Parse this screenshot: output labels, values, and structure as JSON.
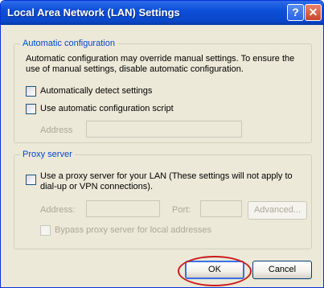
{
  "dialog": {
    "title": "Local Area Network (LAN) Settings",
    "help_glyph": "?",
    "close_glyph": "✕"
  },
  "auto_config": {
    "legend": "Automatic configuration",
    "description_line1": "Automatic configuration may override manual settings.  To ensure the",
    "description_line2": "use of manual settings, disable automatic configuration.",
    "detect_label": "Automatically detect settings",
    "detect_checked": false,
    "script_label": "Use automatic configuration script",
    "script_checked": false,
    "address_label": "Address",
    "address_value": ""
  },
  "proxy": {
    "legend": "Proxy server",
    "use_proxy_line1": "Use a proxy server for your LAN (These settings will not apply to",
    "use_proxy_line2": "dial-up or VPN connections).",
    "use_proxy_checked": false,
    "address_label": "Address:",
    "address_value": "",
    "port_label": "Port:",
    "port_value": "",
    "advanced_label": "Advanced...",
    "bypass_label": "Bypass proxy server for local addresses",
    "bypass_checked": false
  },
  "buttons": {
    "ok_label": "OK",
    "cancel_label": "Cancel"
  },
  "colors": {
    "titlebar": "#0c4fd9",
    "group_legend": "#0046d5",
    "highlight_ring": "#cc1a1a"
  }
}
